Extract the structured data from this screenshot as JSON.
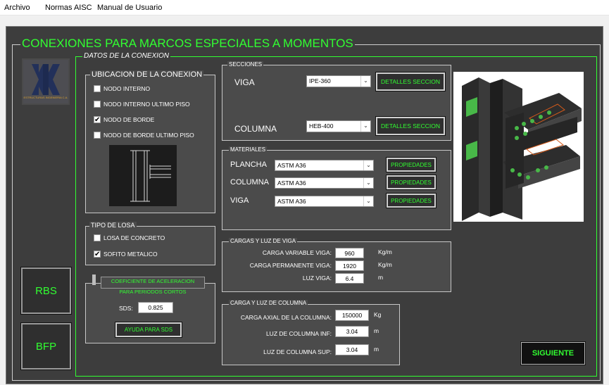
{
  "menu": [
    "Archivo",
    "Normas AISC",
    "Manual de Usuario"
  ],
  "app_title": "CONEXIONES PARA MARCOS ESPECIALES A MOMENTOS",
  "datos_title": "DATOS DE LA CONEXION",
  "logo_text": "ESTRUCTURAS INGENIERIA C.A.",
  "ubicacion": {
    "title": "UBICACION DE LA CONEXION",
    "options": [
      {
        "label": "NODO INTERNO",
        "checked": false
      },
      {
        "label": "NODO INTERNO ULTIMO PISO",
        "checked": false
      },
      {
        "label": "NODO DE BORDE",
        "checked": true
      },
      {
        "label": "NODO DE BORDE ULTIMO PISO",
        "checked": false
      }
    ]
  },
  "tipo_losa": {
    "title": "TIPO DE LOSA",
    "options": [
      {
        "label": "LOSA DE CONCRETO",
        "checked": false
      },
      {
        "label": "SOFITO METALICO",
        "checked": true
      }
    ]
  },
  "coef": {
    "title_line1": "COEFICIENTE DE ACELERACION",
    "title_line2": "PARA PERIODOS CORTOS",
    "sds_label": "SDS:",
    "sds_value": "0.825",
    "help_button": "AYUDA PARA SDS"
  },
  "side_buttons": {
    "rbs": "RBS",
    "bfp": "BFP"
  },
  "secciones": {
    "title": "SECCIONES",
    "viga_label": "VIGA",
    "viga_value": "IPE-360",
    "columna_label": "COLUMNA",
    "columna_value": "HEB-400",
    "details_button": "DETALLES SECCION"
  },
  "materiales": {
    "title": "MATERIALES",
    "rows": [
      {
        "label": "PLANCHA",
        "value": "ASTM A36"
      },
      {
        "label": "COLUMNA",
        "value": "ASTM A36"
      },
      {
        "label": "VIGA",
        "value": "ASTM A36"
      }
    ],
    "button": "PROPIEDADES"
  },
  "cargas_viga": {
    "title": "CARGAS Y LUZ DE VIGA",
    "rows": [
      {
        "label": "CARGA VARIABLE VIGA:",
        "value": "960",
        "unit": "Kg/m"
      },
      {
        "label": "CARGA PERMANENTE VIGA:",
        "value": "1920",
        "unit": "Kg/m"
      },
      {
        "label": "LUZ VIGA:",
        "value": "6.4",
        "unit": "m"
      }
    ]
  },
  "carga_columna": {
    "title": "CARGA Y LUZ DE COLUMNA",
    "rows": [
      {
        "label": "CARGA AXIAL DE LA COLUMNA:",
        "value": "150000",
        "unit": "Kg"
      },
      {
        "label": "LUZ DE COLUMNA INF:",
        "value": "3.04",
        "unit": "m"
      },
      {
        "label": "LUZ DE COLUMNA SUP:",
        "value": "3.04",
        "unit": "m"
      }
    ]
  },
  "next_button": "SIGUIENTE",
  "colors": {
    "accent_green": "#31ff31",
    "bg": "#3d3d3d",
    "panel": "#4b4b4b"
  }
}
